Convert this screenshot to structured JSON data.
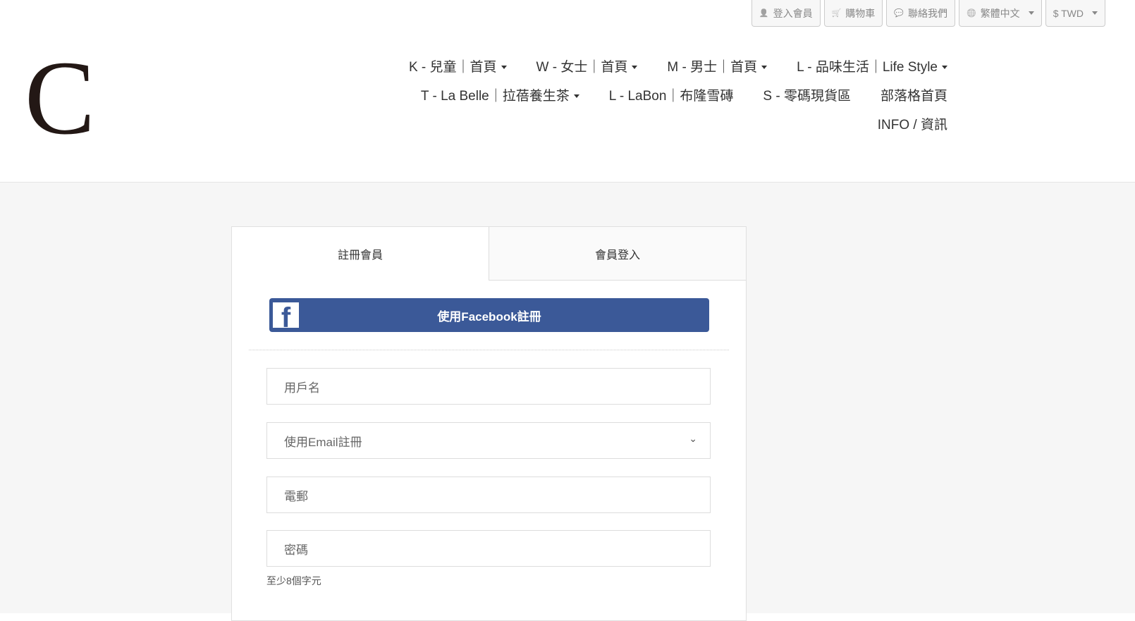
{
  "topbar": [
    {
      "icon": "user-icon",
      "glyph": "👤",
      "label": "登入會員"
    },
    {
      "icon": "cart-icon",
      "glyph": "🛒",
      "label": "購物車"
    },
    {
      "icon": "chat-icon",
      "glyph": "💬",
      "label": "聯絡我們"
    },
    {
      "icon": "globe-icon",
      "glyph": "🌐",
      "label": "繁體中文",
      "dropdown": true
    },
    {
      "icon": "",
      "glyph": "",
      "label": "$ TWD",
      "dropdown": true
    }
  ],
  "logo": "C",
  "nav": [
    {
      "label": "K - 兒童｜首頁",
      "dropdown": true
    },
    {
      "label": "W - 女士｜首頁",
      "dropdown": true
    },
    {
      "label": "M - 男士｜首頁",
      "dropdown": true
    },
    {
      "label": "L - 品味生活｜Life Style",
      "dropdown": true
    },
    {
      "label": "T - La Belle｜拉蓓養生茶",
      "dropdown": true
    },
    {
      "label": "L - LaBon｜布隆雪磚",
      "dropdown": false
    },
    {
      "label": "S - 零碼現貨區",
      "dropdown": false
    },
    {
      "label": "部落格首頁",
      "dropdown": false
    },
    {
      "label": "INFO / 資訊",
      "dropdown": false
    }
  ],
  "form": {
    "tabs": [
      "註冊會員",
      "會員登入"
    ],
    "facebook_label": "使用Facebook註冊",
    "facebook_color": "#3b5998",
    "username_placeholder": "用戶名",
    "register_method": "使用Email註冊",
    "email_placeholder": "電郵",
    "password_placeholder": "密碼",
    "password_hint": "至少8個字元"
  }
}
